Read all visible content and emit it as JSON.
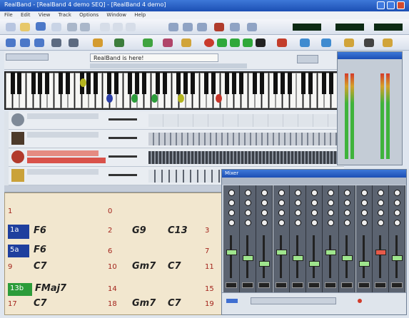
{
  "window": {
    "title": "RealBand - [RealBand 4 demo SEQ] - [RealBand 4 demo]"
  },
  "menu": [
    "File",
    "Edit",
    "View",
    "Track",
    "Options",
    "Window",
    "Help"
  ],
  "message": {
    "text": "RealBand is here!"
  },
  "chord_sheet": {
    "bars": [
      {
        "num": "1",
        "label": "1a",
        "label_color": "#1f3f9e",
        "chord1": "",
        "chord2": ""
      },
      {
        "num": "0",
        "chord1": ""
      },
      {
        "num": "1a",
        "chord1": "F6"
      },
      {
        "num": "2",
        "chord1": "G9",
        "chord2": "C13"
      },
      {
        "num": "3",
        "chord1": ""
      },
      {
        "num": "5a",
        "chord1": "F6"
      },
      {
        "num": "6",
        "chord1": ""
      },
      {
        "num": "7",
        "chord1": ""
      },
      {
        "num": "9",
        "chord1": "C7"
      },
      {
        "num": "10",
        "chord1": "Gm7",
        "chord2": "C7"
      },
      {
        "num": "11",
        "chord1": ""
      },
      {
        "num": "13b",
        "chord1": "FMaj7"
      },
      {
        "num": "14",
        "chord1": ""
      },
      {
        "num": "15",
        "chord1": ""
      },
      {
        "num": "17",
        "chord1": "C7"
      },
      {
        "num": "18",
        "chord1": "Gm7",
        "chord2": "C7"
      },
      {
        "num": "19",
        "chord1": ""
      }
    ]
  },
  "mixer": {
    "title": "Mixer"
  },
  "colors": {
    "part_a": "#1f3f9e",
    "part_b": "#2c9c3a",
    "accent": "#d13b2a"
  }
}
